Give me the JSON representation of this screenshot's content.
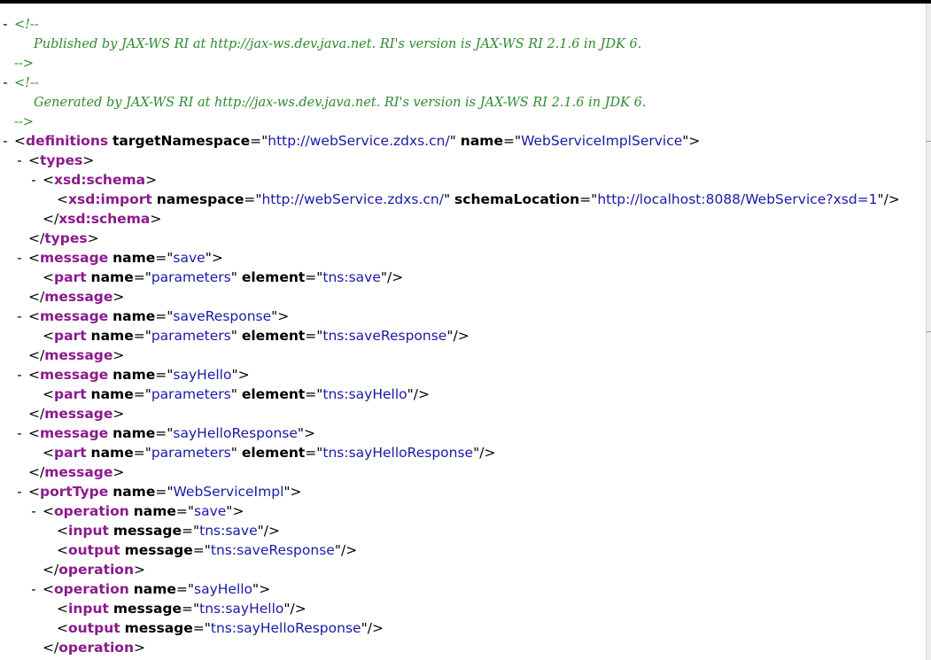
{
  "comments": [
    {
      "open": "<!--",
      "text": "Published by JAX-WS RI at http://jax-ws.dev.java.net. RI's version is JAX-WS RI 2.1.6 in JDK 6.",
      "close": "-->"
    },
    {
      "open": "<!--",
      "text": "Generated by JAX-WS RI at http://jax-ws.dev.java.net. RI's version is JAX-WS RI 2.1.6 in JDK 6.",
      "close": "-->"
    }
  ],
  "toggle_symbol": "-",
  "lines": [
    {
      "type": "comment-open",
      "toggle": true,
      "indent": 0,
      "comment": 0
    },
    {
      "type": "comment-text",
      "indent": 1,
      "comment": 0
    },
    {
      "type": "comment-close",
      "indent": 0,
      "comment": 0
    },
    {
      "type": "comment-open",
      "toggle": true,
      "indent": 0,
      "comment": 1
    },
    {
      "type": "comment-text",
      "indent": 1,
      "comment": 1
    },
    {
      "type": "comment-close",
      "indent": 0,
      "comment": 1
    },
    {
      "type": "open",
      "toggle": true,
      "indent": 0,
      "tag": "definitions",
      "attrs": [
        [
          "targetNamespace",
          "http://webService.zdxs.cn/"
        ],
        [
          "name",
          "WebServiceImplService"
        ]
      ]
    },
    {
      "type": "open",
      "toggle": true,
      "indent": 1,
      "tag": "types",
      "attrs": []
    },
    {
      "type": "open",
      "toggle": true,
      "indent": 2,
      "tag": "xsd:schema",
      "attrs": []
    },
    {
      "type": "empty",
      "indent": 3,
      "tag": "xsd:import",
      "attrs": [
        [
          "namespace",
          "http://webService.zdxs.cn/"
        ],
        [
          "schemaLocation",
          "http://localhost:8088/WebService?xsd=1"
        ]
      ]
    },
    {
      "type": "close",
      "indent": 2,
      "tag": "xsd:schema"
    },
    {
      "type": "close",
      "indent": 1,
      "tag": "types"
    },
    {
      "type": "open",
      "toggle": true,
      "indent": 1,
      "tag": "message",
      "attrs": [
        [
          "name",
          "save"
        ]
      ]
    },
    {
      "type": "empty",
      "indent": 2,
      "tag": "part",
      "attrs": [
        [
          "name",
          "parameters"
        ],
        [
          "element",
          "tns:save"
        ]
      ]
    },
    {
      "type": "close",
      "indent": 1,
      "tag": "message"
    },
    {
      "type": "open",
      "toggle": true,
      "indent": 1,
      "tag": "message",
      "attrs": [
        [
          "name",
          "saveResponse"
        ]
      ]
    },
    {
      "type": "empty",
      "indent": 2,
      "tag": "part",
      "attrs": [
        [
          "name",
          "parameters"
        ],
        [
          "element",
          "tns:saveResponse"
        ]
      ]
    },
    {
      "type": "close",
      "indent": 1,
      "tag": "message"
    },
    {
      "type": "open",
      "toggle": true,
      "indent": 1,
      "tag": "message",
      "attrs": [
        [
          "name",
          "sayHello"
        ]
      ]
    },
    {
      "type": "empty",
      "indent": 2,
      "tag": "part",
      "attrs": [
        [
          "name",
          "parameters"
        ],
        [
          "element",
          "tns:sayHello"
        ]
      ]
    },
    {
      "type": "close",
      "indent": 1,
      "tag": "message"
    },
    {
      "type": "open",
      "toggle": true,
      "indent": 1,
      "tag": "message",
      "attrs": [
        [
          "name",
          "sayHelloResponse"
        ]
      ]
    },
    {
      "type": "empty",
      "indent": 2,
      "tag": "part",
      "attrs": [
        [
          "name",
          "parameters"
        ],
        [
          "element",
          "tns:sayHelloResponse"
        ]
      ]
    },
    {
      "type": "close",
      "indent": 1,
      "tag": "message"
    },
    {
      "type": "open",
      "toggle": true,
      "indent": 1,
      "tag": "portType",
      "attrs": [
        [
          "name",
          "WebServiceImpl"
        ]
      ]
    },
    {
      "type": "open",
      "toggle": true,
      "indent": 2,
      "tag": "operation",
      "attrs": [
        [
          "name",
          "save"
        ]
      ]
    },
    {
      "type": "empty",
      "indent": 3,
      "tag": "input",
      "attrs": [
        [
          "message",
          "tns:save"
        ]
      ]
    },
    {
      "type": "empty",
      "indent": 3,
      "tag": "output",
      "attrs": [
        [
          "message",
          "tns:saveResponse"
        ]
      ]
    },
    {
      "type": "close",
      "indent": 2,
      "tag": "operation"
    },
    {
      "type": "open",
      "toggle": true,
      "indent": 2,
      "tag": "operation",
      "attrs": [
        [
          "name",
          "sayHello"
        ]
      ]
    },
    {
      "type": "empty",
      "indent": 3,
      "tag": "input",
      "attrs": [
        [
          "message",
          "tns:sayHello"
        ]
      ]
    },
    {
      "type": "empty",
      "indent": 3,
      "tag": "output",
      "attrs": [
        [
          "message",
          "tns:sayHelloResponse"
        ]
      ]
    },
    {
      "type": "close",
      "indent": 2,
      "tag": "operation"
    }
  ]
}
